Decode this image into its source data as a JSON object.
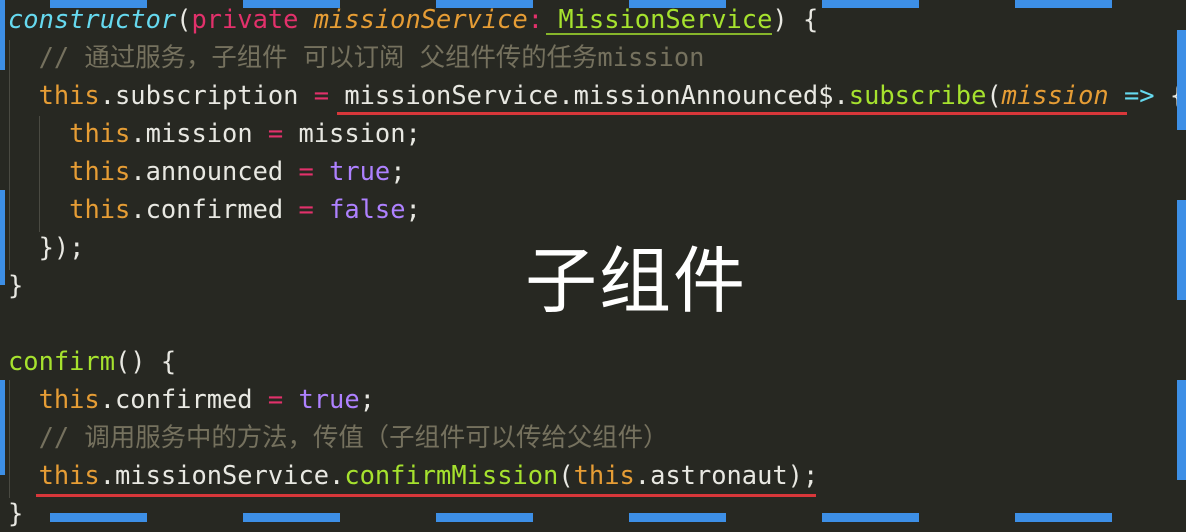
{
  "overlay_label": "子组件",
  "lines": [
    [
      [
        "ctor",
        "constructor"
      ],
      [
        "pl",
        "("
      ],
      [
        "pk",
        "private "
      ],
      [
        "par",
        "missionService"
      ],
      [
        "pk",
        ":"
      ],
      [
        "pl",
        " "
      ],
      [
        "ty",
        "MissionService"
      ],
      [
        "pl",
        ") {"
      ]
    ],
    [
      [
        "cm",
        "  // 通过服务，子组件 可以订阅 父组件传的任务mission"
      ]
    ],
    [
      [
        "pl",
        "  "
      ],
      [
        "kw",
        "this"
      ],
      [
        "pl",
        ".subscription "
      ],
      [
        "pk",
        "="
      ],
      [
        "pl",
        " missionService.missionAnnounced$."
      ],
      [
        "fn",
        "subscribe"
      ],
      [
        "pl",
        "("
      ],
      [
        "par",
        "mission"
      ],
      [
        "pl",
        " "
      ],
      [
        "ar",
        "=>"
      ],
      [
        "pl",
        " {"
      ]
    ],
    [
      [
        "pl",
        "    "
      ],
      [
        "kw",
        "this"
      ],
      [
        "pl",
        ".mission "
      ],
      [
        "pk",
        "="
      ],
      [
        "pl",
        " mission;"
      ]
    ],
    [
      [
        "pl",
        "    "
      ],
      [
        "kw",
        "this"
      ],
      [
        "pl",
        ".announced "
      ],
      [
        "pk",
        "="
      ],
      [
        "pl",
        " "
      ],
      [
        "bool",
        "true"
      ],
      [
        "pl",
        ";"
      ]
    ],
    [
      [
        "pl",
        "    "
      ],
      [
        "kw",
        "this"
      ],
      [
        "pl",
        ".confirmed "
      ],
      [
        "pk",
        "="
      ],
      [
        "pl",
        " "
      ],
      [
        "bool",
        "false"
      ],
      [
        "pl",
        ";"
      ]
    ],
    [
      [
        "pl",
        "  });"
      ]
    ],
    [
      [
        "pl",
        "}"
      ]
    ],
    [
      [
        "pl",
        ""
      ]
    ],
    [
      [
        "fn",
        "confirm"
      ],
      [
        "pl",
        "() {"
      ]
    ],
    [
      [
        "pl",
        "  "
      ],
      [
        "kw",
        "this"
      ],
      [
        "pl",
        ".confirmed "
      ],
      [
        "pk",
        "="
      ],
      [
        "pl",
        " "
      ],
      [
        "bool",
        "true"
      ],
      [
        "pl",
        ";"
      ]
    ],
    [
      [
        "cm",
        "  // 调用服务中的方法，传值（子组件可以传给父组件）"
      ]
    ],
    [
      [
        "pl",
        "  "
      ],
      [
        "kw",
        "this"
      ],
      [
        "pl",
        ".missionService."
      ],
      [
        "fn",
        "confirmMission"
      ],
      [
        "pl",
        "("
      ],
      [
        "kw",
        "this"
      ],
      [
        "pl",
        ".astronaut);"
      ]
    ],
    [
      [
        "pl",
        "}"
      ]
    ]
  ],
  "colors": {
    "background": "#272822",
    "dash": "#3d8fe6",
    "underline": "#d8373a"
  }
}
